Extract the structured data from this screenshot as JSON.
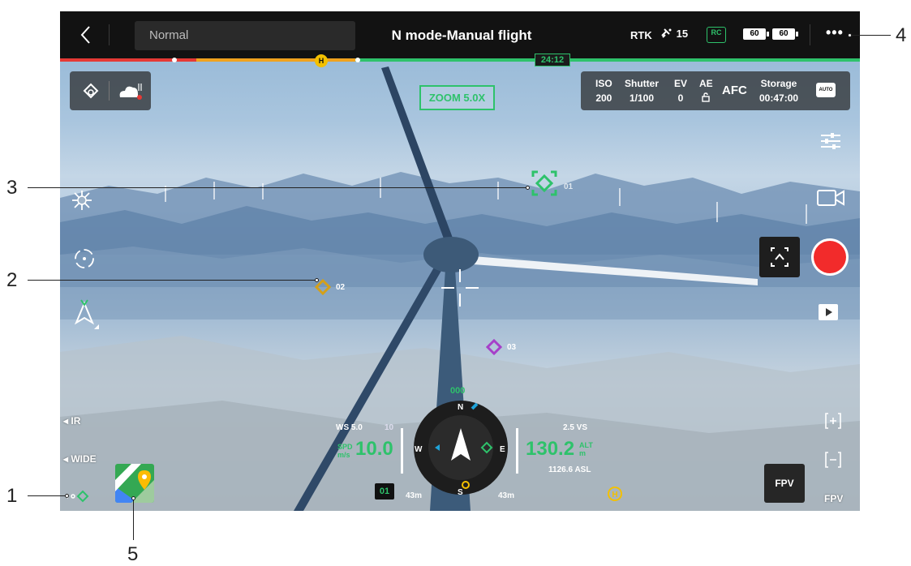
{
  "topbar": {
    "back_icon": "chevron-left-icon",
    "flight_mode": "Normal",
    "title": "N mode-Manual flight",
    "rtk": "RTK",
    "satellite_count": "15",
    "rc_label": "RC",
    "battery_1": "60",
    "battery_2": "60",
    "more_label": "•••"
  },
  "progress": {
    "timer": "24:12",
    "home_marker": "H",
    "colors": {
      "red": "#e53935",
      "orange": "#f0a21e",
      "green": "#2ec26b"
    }
  },
  "left_panel": {
    "icons": [
      "map-pin-signal-icon",
      "cloud-upload-icon"
    ]
  },
  "zoom": "ZOOM 5.0X",
  "camera": {
    "iso_label": "ISO",
    "iso_value": "200",
    "shutter_label": "Shutter",
    "shutter_value": "1/100",
    "ev_label": "EV",
    "ev_value": "0",
    "ae_label": "AE",
    "afc": "AFC",
    "storage_label": "Storage",
    "storage_value": "00:47:00",
    "auto_badge": "AUTO"
  },
  "waypoints": [
    {
      "label": "01",
      "color": "#2ec26b"
    },
    {
      "label": "02",
      "color": "#d4a019"
    },
    {
      "label": "03",
      "color": "#a640c9"
    }
  ],
  "left_side": {
    "ir": "IR",
    "wide": "WIDE"
  },
  "right_side": {
    "fpv_button": "FPV",
    "fpv_switch": "FPV"
  },
  "telemetry": {
    "heading": "000",
    "north": "N",
    "south": "S",
    "west": "W",
    "east": "E",
    "ws": "WS 5.0",
    "ws_unit": "10",
    "spd_label": "SPD",
    "spd_unit": "m/s",
    "speed": "10.0",
    "altitude": "130.2",
    "alt_label": "ALT",
    "alt_unit": "m",
    "vs": "2.5 VS",
    "asl": "1126.6 ASL",
    "distance_left": "43m",
    "distance_right": "43m",
    "waypoint_tag": "01",
    "home_marker": "H"
  },
  "callouts": [
    "1",
    "2",
    "3",
    "4",
    "5"
  ]
}
